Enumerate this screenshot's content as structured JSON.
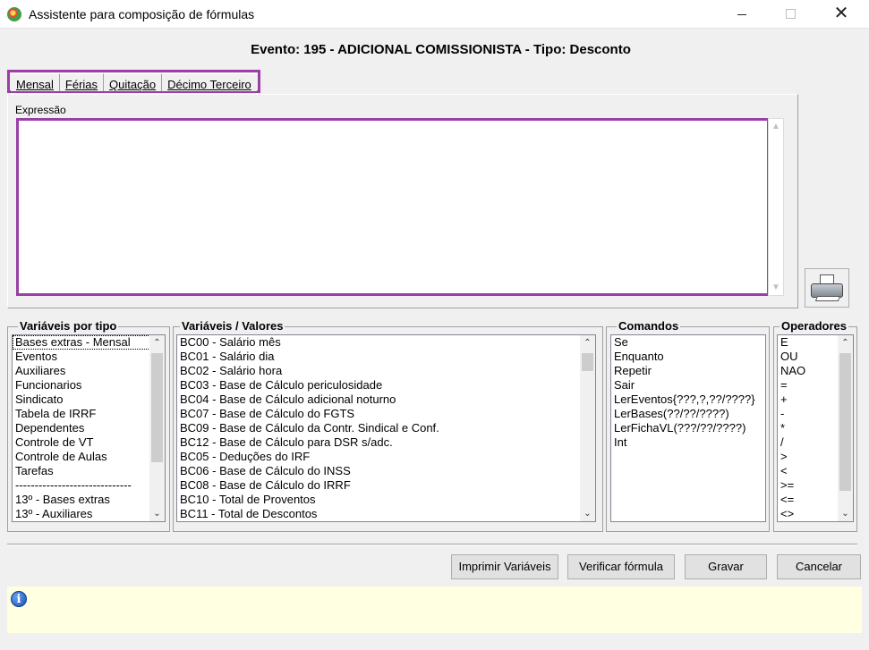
{
  "window": {
    "title": "Assistente para composição de fórmulas",
    "minimize": "—",
    "maximize": "☐",
    "close": "✕"
  },
  "header": {
    "event_title": "Evento: 195 - ADICIONAL COMISSIONISTA - Tipo: Desconto"
  },
  "tabs": [
    {
      "label": "Mensal",
      "active": true
    },
    {
      "label": "Férias",
      "active": false
    },
    {
      "label": "Quitação",
      "active": false
    },
    {
      "label": "Décimo Terceiro",
      "active": false
    }
  ],
  "expression": {
    "label": "Expressão",
    "value": ""
  },
  "groups": {
    "variables_by_type": {
      "title": "Variáveis por tipo",
      "items": [
        "Bases extras - Mensal",
        "Eventos",
        "Auxiliares",
        "Funcionarios",
        "Sindicato",
        "Tabela de IRRF",
        "Dependentes",
        "Controle de VT",
        "Controle de Aulas",
        "Tarefas",
        "------------------------------",
        "13º - Bases extras",
        "13º - Auxiliares"
      ],
      "selected": "Bases extras - Mensal"
    },
    "variables_values": {
      "title": "Variáveis / Valores",
      "items": [
        "BC00 - Salário mês",
        "BC01 - Salário dia",
        "BC02 - Salário hora",
        "BC03 - Base de Cálculo periculosidade",
        "BC04 - Base de Cálculo adicional noturno",
        "BC07 - Base de Cálculo do FGTS",
        "BC09 - Base de Cálculo da Contr. Sindical e Conf.",
        "BC12 - Base de Cálculo para DSR s/adc.",
        "BC05 - Deduções do IRF",
        "BC06 - Base de Cálculo do INSS",
        "BC08 - Base de Cálculo do IRRF",
        "BC10 - Total de Proventos",
        "BC11 - Total de Descontos"
      ]
    },
    "commands": {
      "title": "Comandos",
      "items": [
        "Se",
        "Enquanto",
        "Repetir",
        "Sair",
        "LerEventos{???,?,??/????}",
        "LerBases(??/??/????)",
        "LerFichaVL(???/??/????)",
        "Int"
      ]
    },
    "operators": {
      "title": "Operadores",
      "items": [
        "E",
        "OU",
        "NAO",
        "=",
        "+",
        "-",
        "*",
        "/",
        ">",
        "<",
        ">=",
        "<=",
        "<>"
      ]
    }
  },
  "buttons": {
    "print_variables": "Imprimir Variáveis",
    "verify_formula": "Verificar fórmula",
    "save": "Gravar",
    "cancel": "Cancelar"
  },
  "icons": {
    "app": "formula-assistant-icon",
    "printer": "printer-icon",
    "info": "info-icon"
  },
  "colors": {
    "highlight_border": "#9b3fa6",
    "status_background": "#ffffe1"
  }
}
